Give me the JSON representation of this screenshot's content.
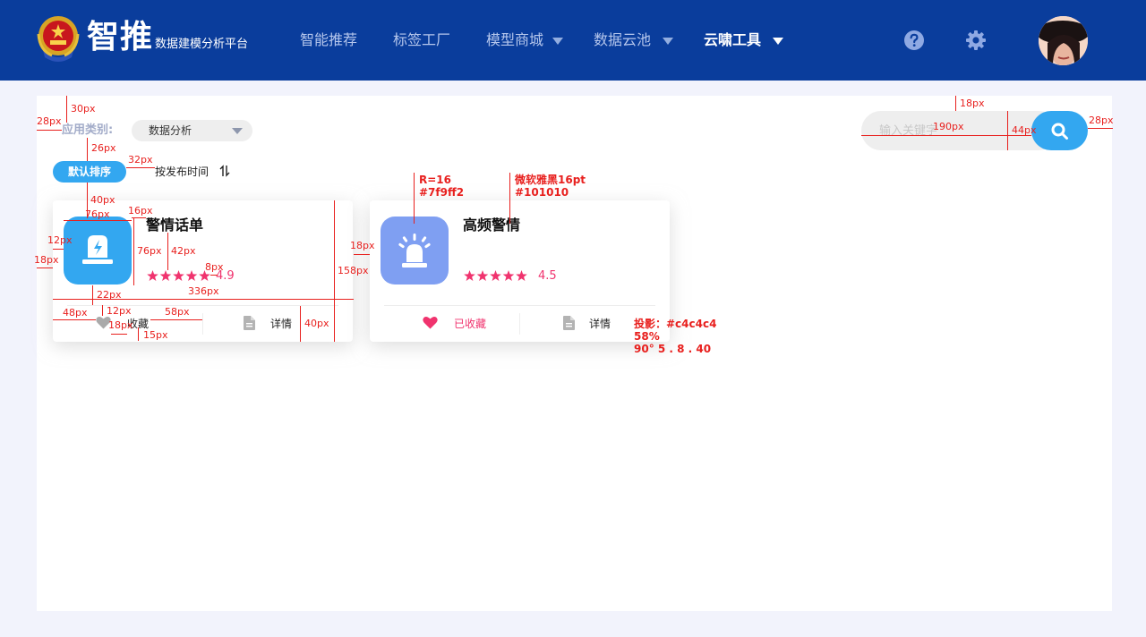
{
  "header": {
    "brand": "智推",
    "subtitle": "数据建模分析平台",
    "nav": [
      {
        "label": "智能推荐"
      },
      {
        "label": "标签工厂"
      },
      {
        "label": "模型商城"
      },
      {
        "label": "数据云池"
      },
      {
        "label": "云啸工具"
      }
    ],
    "active_nav": "云啸工具",
    "icons": [
      "help-icon",
      "settings-icon"
    ]
  },
  "filters": {
    "category_label": "应用类别:",
    "category_value": "数据分析",
    "sort_default": "默认排序",
    "sort_by_time": "按发布时间"
  },
  "search": {
    "placeholder": "输入关键字",
    "value": ""
  },
  "cards": [
    {
      "title": "警情话单",
      "rating": "4.9",
      "stars": 5,
      "icon": "document-dispatch-icon",
      "icon_color": "#33a7f0",
      "fav_label": "收藏",
      "favorited": false,
      "detail_label": "详情"
    },
    {
      "title": "高频警情",
      "rating": "4.5",
      "stars": 5,
      "icon": "alarm-siren-icon",
      "icon_color": "#7f9ff2",
      "fav_label": "已收藏",
      "favorited": true,
      "detail_label": "详情"
    }
  ],
  "annotations": {
    "a30": "30px",
    "a28l": "28px",
    "a26": "26px",
    "a32": "32px",
    "a40": "40px",
    "a76w": "76px",
    "a16": "16px",
    "a12": "12px",
    "a76h": "76px",
    "a42": "42px",
    "a18l": "18px",
    "a8": "8px",
    "a158": "158px",
    "a18m": "18px",
    "a22": "22px",
    "a336": "336px",
    "a48": "48px",
    "a12b": "12px",
    "a58": "58px",
    "a18b": "18px",
    "a15": "15px",
    "a40b": "40px",
    "a18t": "18px",
    "a190": "190px",
    "a44": "44px",
    "a28r": "28px",
    "radius": "R=16",
    "radius_color": "#7f9ff2",
    "font": "微软雅黑16pt",
    "font_color": "#101010",
    "shadow1": "投影：#c4c4c4",
    "shadow2": "58%",
    "shadow3": "90° 5 . 8 . 40"
  },
  "colors": {
    "header_bg": "#0a3d9c",
    "accent": "#33a7f0",
    "favorite": "#f0336e",
    "panel_bg": "#ffffff",
    "page_bg": "#f2f3fc",
    "annotation": "#e8201e"
  }
}
